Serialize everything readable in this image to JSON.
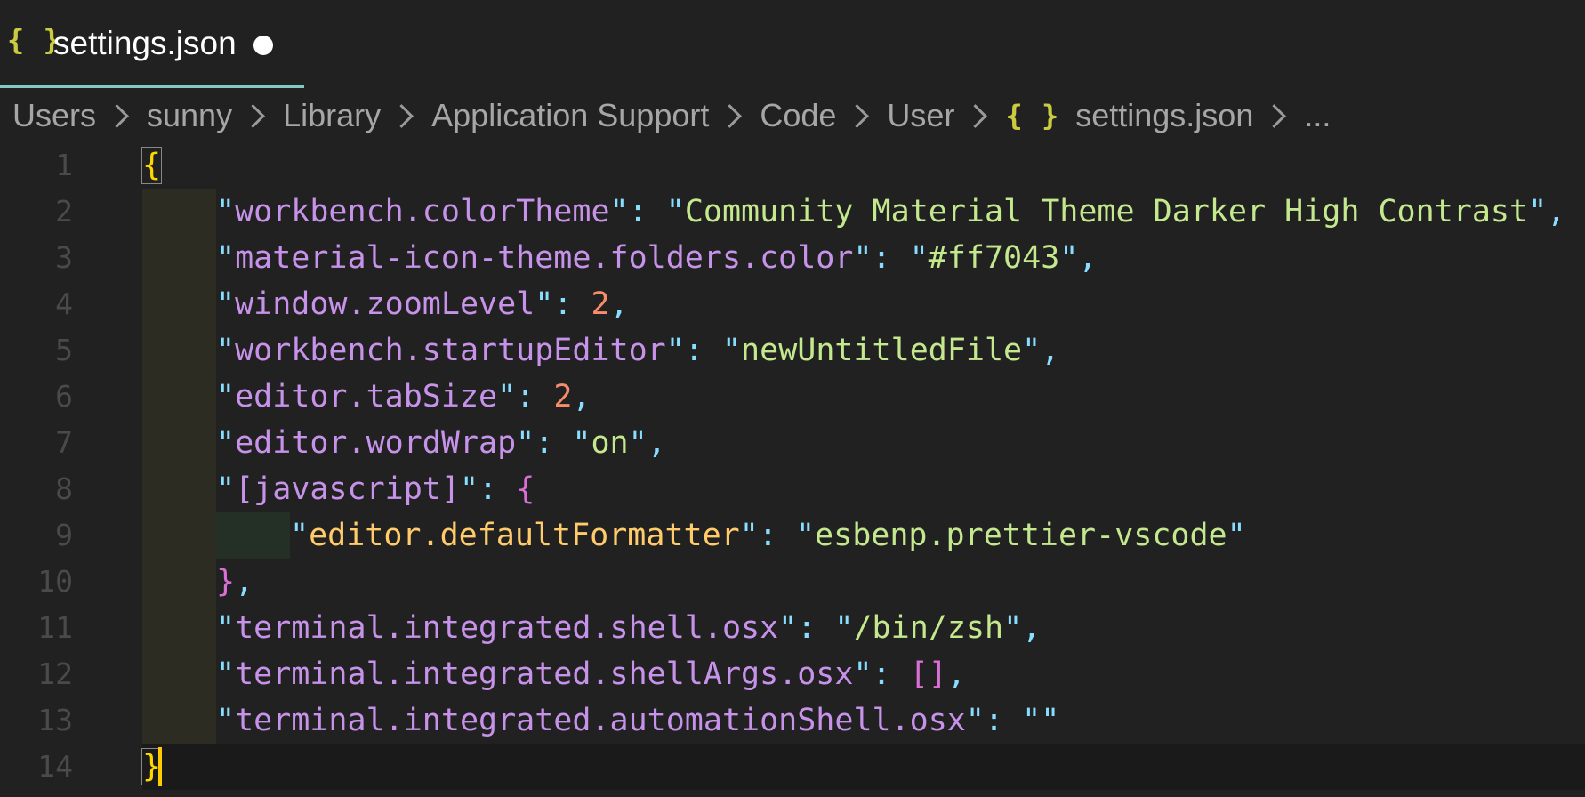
{
  "tab": {
    "icon": "{ }",
    "title": "settings.json",
    "dirty_indicator": "dot-icon"
  },
  "breadcrumb": {
    "items": [
      "Users",
      "sunny",
      "Library",
      "Application Support",
      "Code",
      "User"
    ],
    "file_icon": "{ }",
    "file": "settings.json",
    "ellipsis": "..."
  },
  "editor": {
    "line_numbers": [
      "1",
      "2",
      "3",
      "4",
      "5",
      "6",
      "7",
      "8",
      "9",
      "10",
      "11",
      "12",
      "13",
      "14"
    ],
    "lines": [
      [
        [
          "b1",
          "{"
        ]
      ],
      [
        [
          "p",
          "\""
        ],
        [
          "k",
          "workbench.colorTheme"
        ],
        [
          "p",
          "\""
        ],
        [
          "p",
          ": "
        ],
        [
          "p",
          "\""
        ],
        [
          "s",
          "Community Material Theme Darker High Contrast"
        ],
        [
          "p",
          "\""
        ],
        [
          "p",
          ","
        ]
      ],
      [
        [
          "p",
          "\""
        ],
        [
          "k",
          "material-icon-theme.folders.color"
        ],
        [
          "p",
          "\""
        ],
        [
          "p",
          ": "
        ],
        [
          "p",
          "\""
        ],
        [
          "s",
          "#ff7043"
        ],
        [
          "p",
          "\""
        ],
        [
          "p",
          ","
        ]
      ],
      [
        [
          "p",
          "\""
        ],
        [
          "k",
          "window.zoomLevel"
        ],
        [
          "p",
          "\""
        ],
        [
          "p",
          ": "
        ],
        [
          "n",
          "2"
        ],
        [
          "p",
          ","
        ]
      ],
      [
        [
          "p",
          "\""
        ],
        [
          "k",
          "workbench.startupEditor"
        ],
        [
          "p",
          "\""
        ],
        [
          "p",
          ": "
        ],
        [
          "p",
          "\""
        ],
        [
          "s",
          "newUntitledFile"
        ],
        [
          "p",
          "\""
        ],
        [
          "p",
          ","
        ]
      ],
      [
        [
          "p",
          "\""
        ],
        [
          "k",
          "editor.tabSize"
        ],
        [
          "p",
          "\""
        ],
        [
          "p",
          ": "
        ],
        [
          "n",
          "2"
        ],
        [
          "p",
          ","
        ]
      ],
      [
        [
          "p",
          "\""
        ],
        [
          "k",
          "editor.wordWrap"
        ],
        [
          "p",
          "\""
        ],
        [
          "p",
          ": "
        ],
        [
          "p",
          "\""
        ],
        [
          "s",
          "on"
        ],
        [
          "p",
          "\""
        ],
        [
          "p",
          ","
        ]
      ],
      [
        [
          "p",
          "\""
        ],
        [
          "k",
          "[javascript]"
        ],
        [
          "p",
          "\""
        ],
        [
          "p",
          ": "
        ],
        [
          "b2",
          "{"
        ]
      ],
      [
        [
          "p",
          "\""
        ],
        [
          "k2",
          "editor.defaultFormatter"
        ],
        [
          "p",
          "\""
        ],
        [
          "p",
          ": "
        ],
        [
          "p",
          "\""
        ],
        [
          "s",
          "esbenp.prettier-vscode"
        ],
        [
          "p",
          "\""
        ]
      ],
      [
        [
          "b2",
          "}"
        ],
        [
          "p",
          ","
        ]
      ],
      [
        [
          "p",
          "\""
        ],
        [
          "k",
          "terminal.integrated.shell.osx"
        ],
        [
          "p",
          "\""
        ],
        [
          "p",
          ": "
        ],
        [
          "p",
          "\""
        ],
        [
          "s",
          "/bin/zsh"
        ],
        [
          "p",
          "\""
        ],
        [
          "p",
          ","
        ]
      ],
      [
        [
          "p",
          "\""
        ],
        [
          "k",
          "terminal.integrated.shellArgs.osx"
        ],
        [
          "p",
          "\""
        ],
        [
          "p",
          ": "
        ],
        [
          "b2",
          "[]"
        ],
        [
          "p",
          ","
        ]
      ],
      [
        [
          "p",
          "\""
        ],
        [
          "k",
          "terminal.integrated.automationShell.osx"
        ],
        [
          "p",
          "\""
        ],
        [
          "p",
          ": "
        ],
        [
          "p",
          "\"\""
        ]
      ],
      [
        [
          "b1",
          "}"
        ]
      ]
    ],
    "indent_levels": [
      0,
      1,
      1,
      1,
      1,
      1,
      1,
      1,
      2,
      1,
      1,
      1,
      1,
      0
    ],
    "cursor_line": 14
  },
  "colors": {
    "accent": "#80cbc4",
    "cursor": "#ffcc00",
    "json_icon": "#cbcb41"
  }
}
